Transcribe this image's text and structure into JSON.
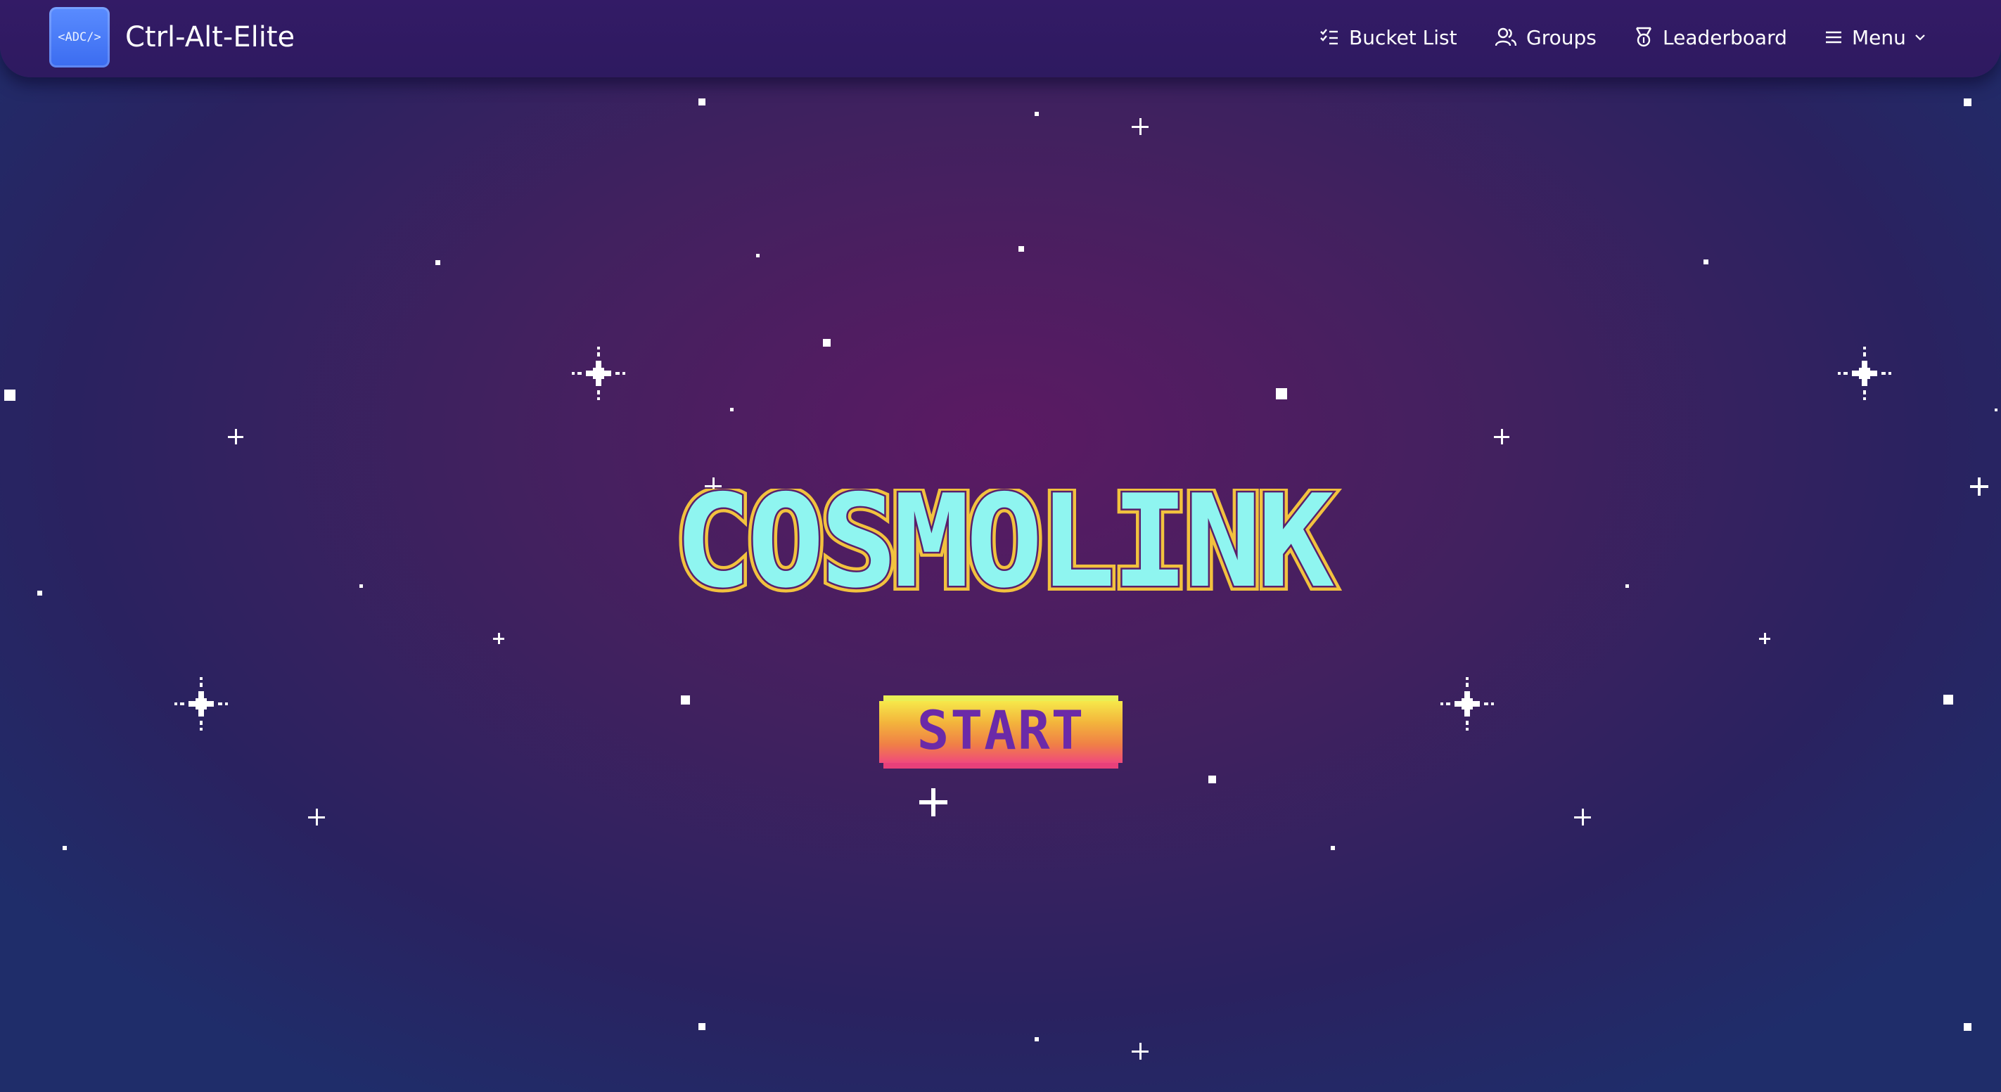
{
  "app": {
    "logo_text": "<ADC/>",
    "brand": "Ctrl-Alt-Elite"
  },
  "nav": {
    "bucket_list": "Bucket List",
    "groups": "Groups",
    "leaderboard": "Leaderboard",
    "menu": "Menu"
  },
  "hero": {
    "title": "COSMOLINK",
    "start": "START"
  },
  "icons": {
    "bucket_list": "checklist-icon",
    "groups": "users-icon",
    "leaderboard": "medal-icon",
    "menu": "hamburger-icon",
    "menu_chevron": "chevron-down-icon"
  },
  "colors": {
    "title_fill": "#8ff5f0",
    "title_outline": "#f2c23e",
    "title_shadow": "#5a1f6b",
    "start_text": "#6b2aa8",
    "start_top": "#f6e84a",
    "start_bottom": "#f04a7c"
  }
}
